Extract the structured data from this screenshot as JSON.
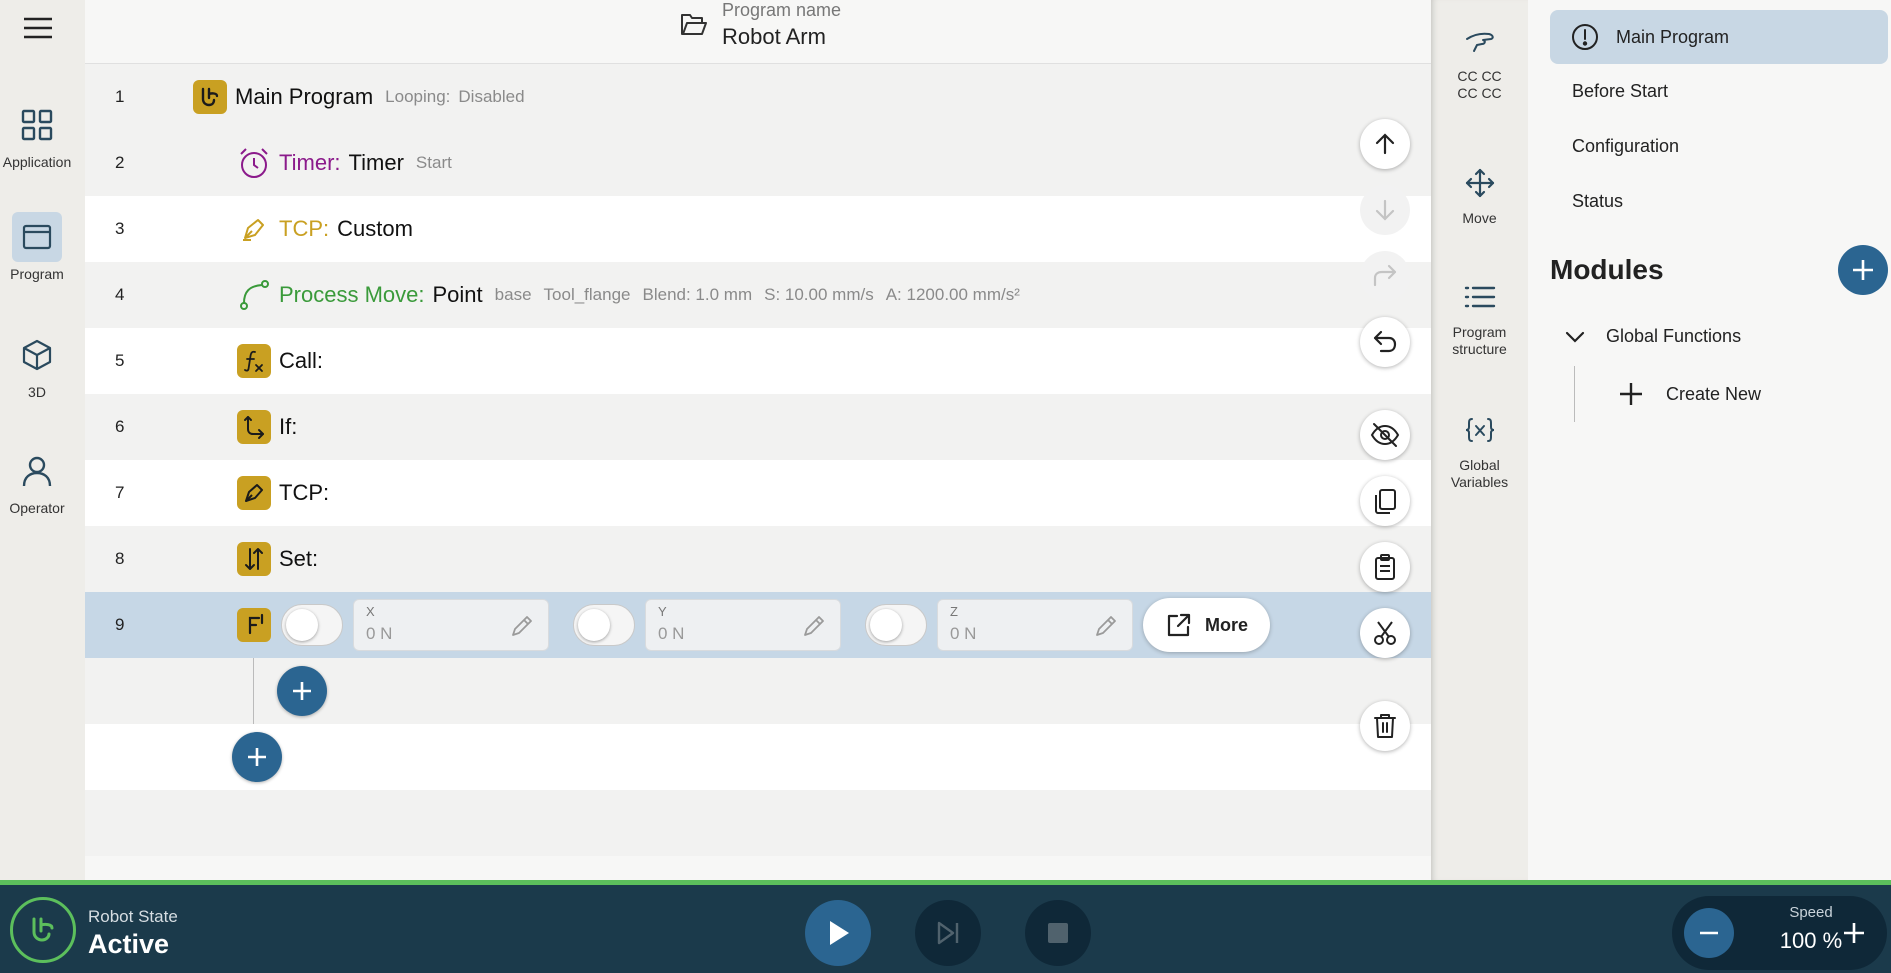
{
  "left_nav": {
    "items": [
      {
        "label": "Application",
        "icon": "grid-icon"
      },
      {
        "label": "Program",
        "icon": "program-window-icon",
        "active": true
      },
      {
        "label": "3D",
        "icon": "cube-icon"
      },
      {
        "label": "Operator",
        "icon": "person-icon"
      }
    ]
  },
  "header": {
    "program_name_label": "Program name",
    "program_name": "Robot Arm"
  },
  "program": {
    "rows": [
      {
        "num": "1",
        "keyword": "Main Program",
        "meta1": "Looping:",
        "meta2": "Disabled"
      },
      {
        "num": "2",
        "keyword": "Timer:",
        "value": "Timer",
        "meta1": "Start"
      },
      {
        "num": "3",
        "keyword": "TCP:",
        "value": "Custom"
      },
      {
        "num": "4",
        "keyword": "Process Move:",
        "value": "Point",
        "meta1": "base",
        "meta2": "Tool_flange",
        "meta3": "Blend: 1.0 mm",
        "meta4": "S: 10.00 mm/s",
        "meta5": "A: 1200.00 mm/s²"
      },
      {
        "num": "5",
        "keyword": "Call:"
      },
      {
        "num": "6",
        "keyword": "If:"
      },
      {
        "num": "7",
        "keyword": "TCP:"
      },
      {
        "num": "8",
        "keyword": "Set:"
      },
      {
        "num": "9",
        "badge_letter": "F"
      }
    ],
    "force_fields": [
      {
        "label": "X",
        "value": "0 N"
      },
      {
        "label": "Y",
        "value": "0 N"
      },
      {
        "label": "Z",
        "value": "0 N"
      }
    ],
    "more_label": "More"
  },
  "tools": {
    "items": [
      {
        "label_line1": "CC CC",
        "label_line2": "CC CC",
        "icon": "hand-icon"
      },
      {
        "label_line1": "Move",
        "label_line2": "",
        "icon": "move-arrows-icon"
      },
      {
        "label_line1": "Program",
        "label_line2": "structure",
        "icon": "list-icon",
        "active": true
      },
      {
        "label_line1": "Global",
        "label_line2": "Variables",
        "icon": "variable-icon"
      }
    ]
  },
  "right_panel": {
    "items": [
      {
        "label": "Main Program",
        "active": true
      },
      {
        "label": "Before Start"
      },
      {
        "label": "Configuration"
      },
      {
        "label": "Status"
      }
    ],
    "modules_title": "Modules",
    "global_functions": "Global Functions",
    "create_new": "Create New"
  },
  "bottom_bar": {
    "state_label": "Robot State",
    "state_value": "Active",
    "speed_label": "Speed",
    "speed_value": "100 %"
  },
  "colors": {
    "accent": "#2b6591",
    "timer": "#8b1a8b",
    "tcp": "#c9a022",
    "move": "#3a9a3a",
    "status_ok": "#5cbf5c",
    "bottom_bg": "#1b3a4b"
  }
}
